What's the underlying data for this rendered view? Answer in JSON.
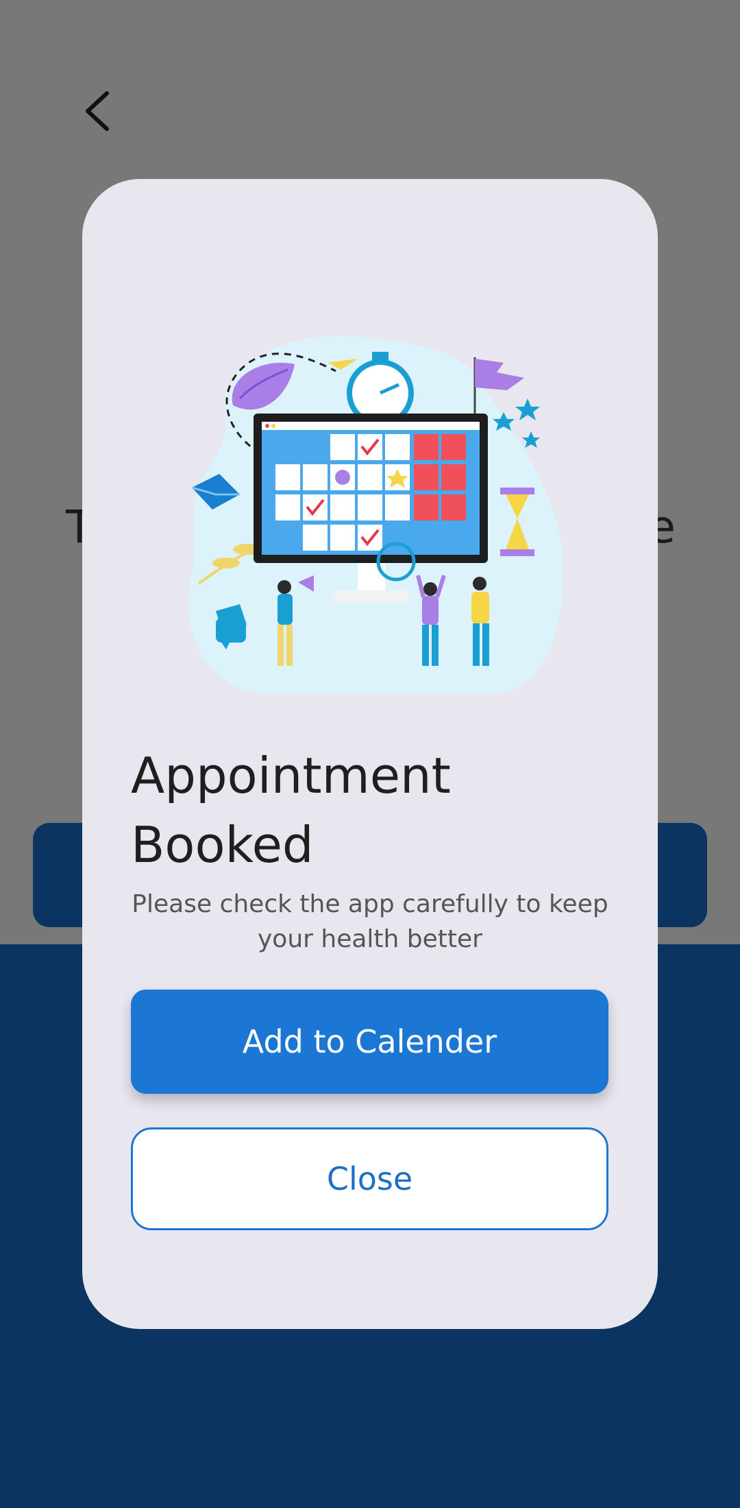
{
  "background": {
    "heading_left": "T",
    "heading_right": "e"
  },
  "modal": {
    "title_line1": "Appointment",
    "title_line2": "Booked",
    "description": "Please check the app carefully to keep your health better",
    "primary_button": "Add to Calender",
    "secondary_button": "Close"
  },
  "icons": {
    "back": "chevron-left-icon",
    "illustration": "calendar-schedule-illustration"
  },
  "colors": {
    "primary": "#1c77d4",
    "navy": "#0b3460",
    "modal_bg": "#e8e6ef",
    "overlay": "#787878"
  }
}
